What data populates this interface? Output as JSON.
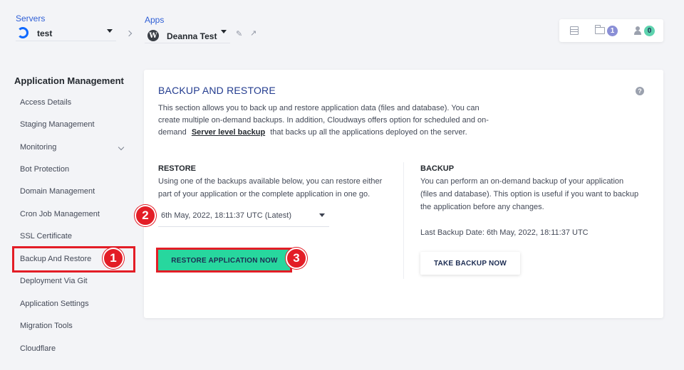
{
  "header": {
    "servers": {
      "label": "Servers",
      "selected": "test"
    },
    "apps": {
      "label": "Apps",
      "selected": "Deanna Test"
    },
    "status": {
      "servers_count": "",
      "projects_count": "1",
      "team_count": "0"
    }
  },
  "sidebar": {
    "title": "Application Management",
    "items": [
      {
        "label": "Access Details"
      },
      {
        "label": "Staging Management"
      },
      {
        "label": "Monitoring"
      },
      {
        "label": "Bot Protection"
      },
      {
        "label": "Domain Management"
      },
      {
        "label": "Cron Job Management"
      },
      {
        "label": "SSL Certificate"
      },
      {
        "label": "Backup And Restore"
      },
      {
        "label": "Deployment Via Git"
      },
      {
        "label": "Application Settings"
      },
      {
        "label": "Migration Tools"
      },
      {
        "label": "Cloudflare"
      }
    ]
  },
  "main": {
    "title": "BACKUP AND RESTORE",
    "desc_line1": "This section allows you to back up and restore application data (files and database). You can",
    "desc_line2": "create multiple on-demand backups. In addition, Cloudways offers option for scheduled and on-",
    "desc_line3_prefix": "demand",
    "desc_link": "Server level backup",
    "desc_line3_suffix": "that backs up all the applications deployed on the server.",
    "restore": {
      "title": "RESTORE",
      "text_line1": "Using one of the backups available below, you can restore either",
      "text_line2": "part of your application or the complete application in one go.",
      "selected_backup": "6th May, 2022, 18:11:37 UTC (Latest)",
      "button": "RESTORE APPLICATION NOW"
    },
    "backup": {
      "title": "BACKUP",
      "text_line1": "You can perform an on-demand backup of your application",
      "text_line2": "(files and database). This option is useful if you want to backup",
      "text_line3": "the application before any changes.",
      "last_backup": "Last Backup Date: 6th May, 2022, 18:11:37 UTC",
      "button": "TAKE BACKUP NOW"
    }
  },
  "annotations": [
    "1",
    "2",
    "3"
  ],
  "colors": {
    "accent_green": "#27d79e",
    "annotation_red": "#e31d26",
    "title_blue": "#233c8f",
    "link_blue": "#2f5fd6"
  }
}
